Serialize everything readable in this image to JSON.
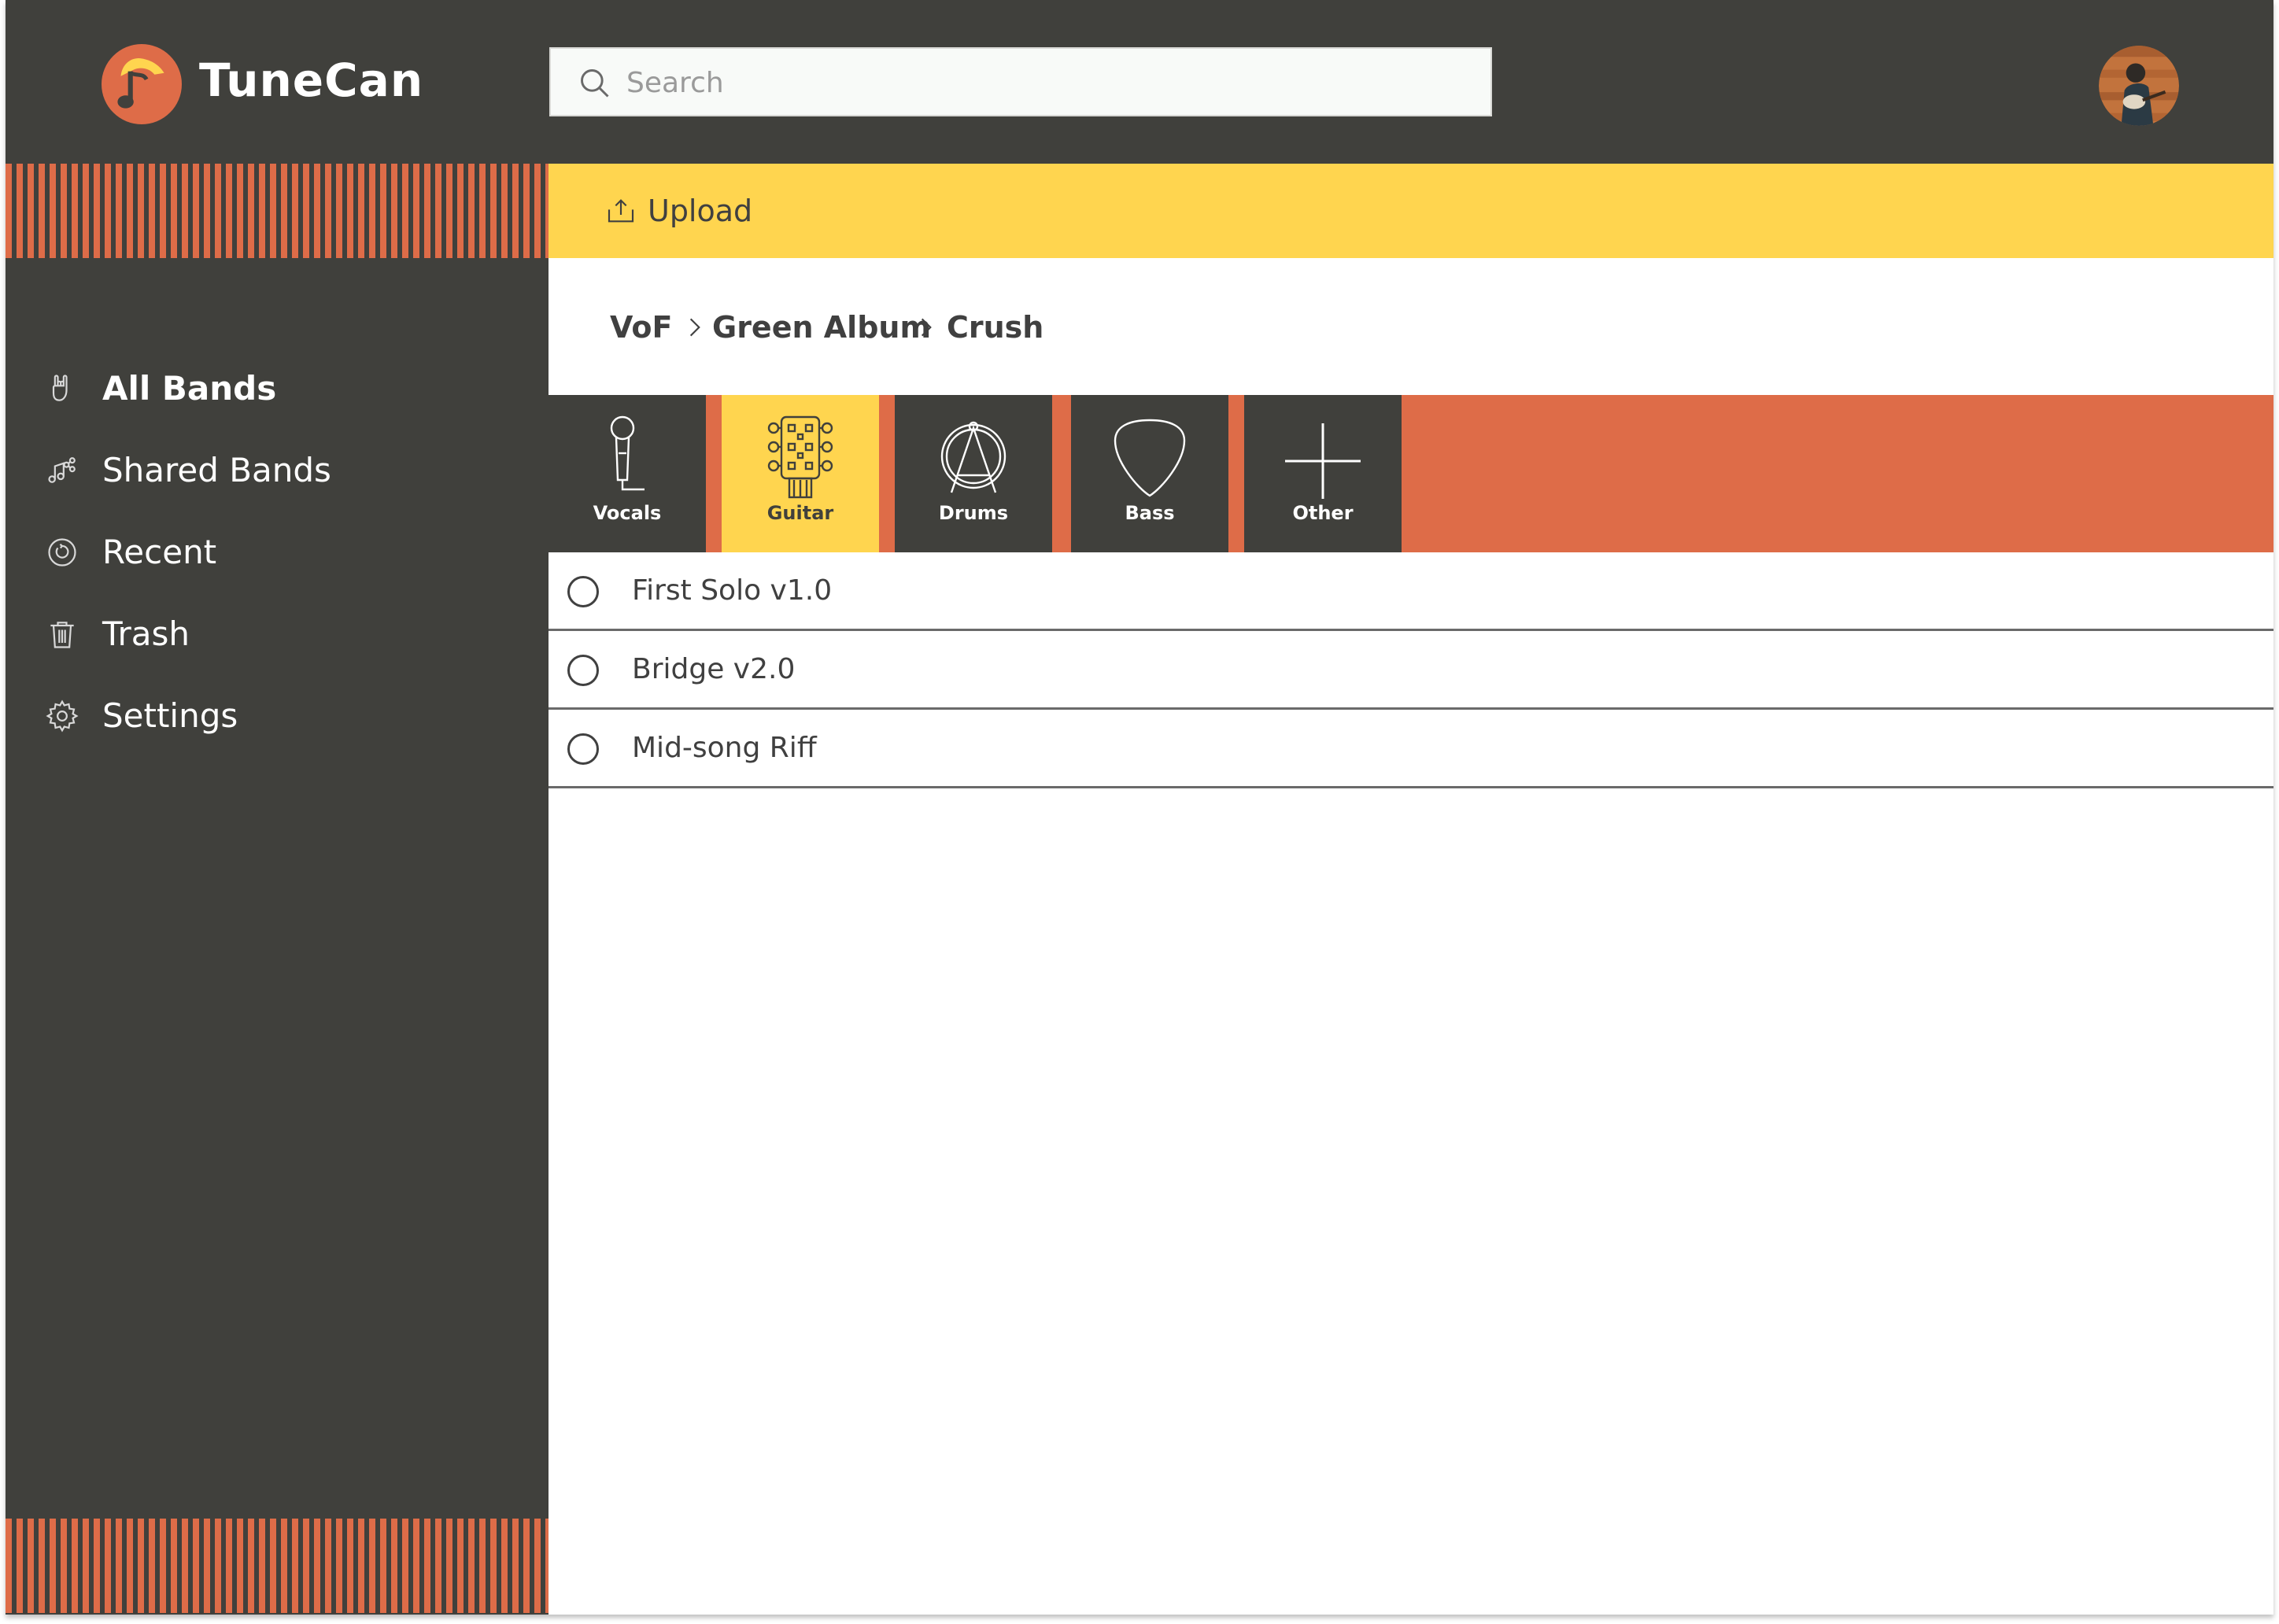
{
  "app": {
    "name": "TuneCan"
  },
  "search": {
    "placeholder": "Search",
    "value": ""
  },
  "user": {
    "avatar": "user-avatar"
  },
  "sidebar": {
    "items": [
      {
        "label": "All Bands",
        "icon": "rock-hand-icon",
        "active": true
      },
      {
        "label": "Shared Bands",
        "icon": "shared-music-icon",
        "active": false
      },
      {
        "label": "Recent",
        "icon": "recent-clock-icon",
        "active": false
      },
      {
        "label": "Trash",
        "icon": "trash-icon",
        "active": false
      },
      {
        "label": "Settings",
        "icon": "gear-icon",
        "active": false
      }
    ]
  },
  "toolbar": {
    "upload_label": "Upload",
    "upload_icon": "upload-icon"
  },
  "breadcrumb": {
    "items": [
      "VoF",
      "Green Album",
      "Crush"
    ]
  },
  "tabs": [
    {
      "label": "Vocals",
      "icon": "microphone-icon",
      "active": false
    },
    {
      "label": "Guitar",
      "icon": "guitar-headstock-icon",
      "active": true
    },
    {
      "label": "Drums",
      "icon": "drum-icon",
      "active": false
    },
    {
      "label": "Bass",
      "icon": "guitar-pick-icon",
      "active": false
    },
    {
      "label": "Other",
      "icon": "plus-icon",
      "active": false
    }
  ],
  "files": [
    {
      "name": "First Solo v1.0",
      "selected": false
    },
    {
      "name": "Bridge v2.0",
      "selected": false
    },
    {
      "name": "Mid-song Riff",
      "selected": false
    }
  ],
  "colors": {
    "dark": "#40403c",
    "accent_orange": "#de6c48",
    "accent_yellow": "#ffd54f",
    "text": "#404040"
  }
}
